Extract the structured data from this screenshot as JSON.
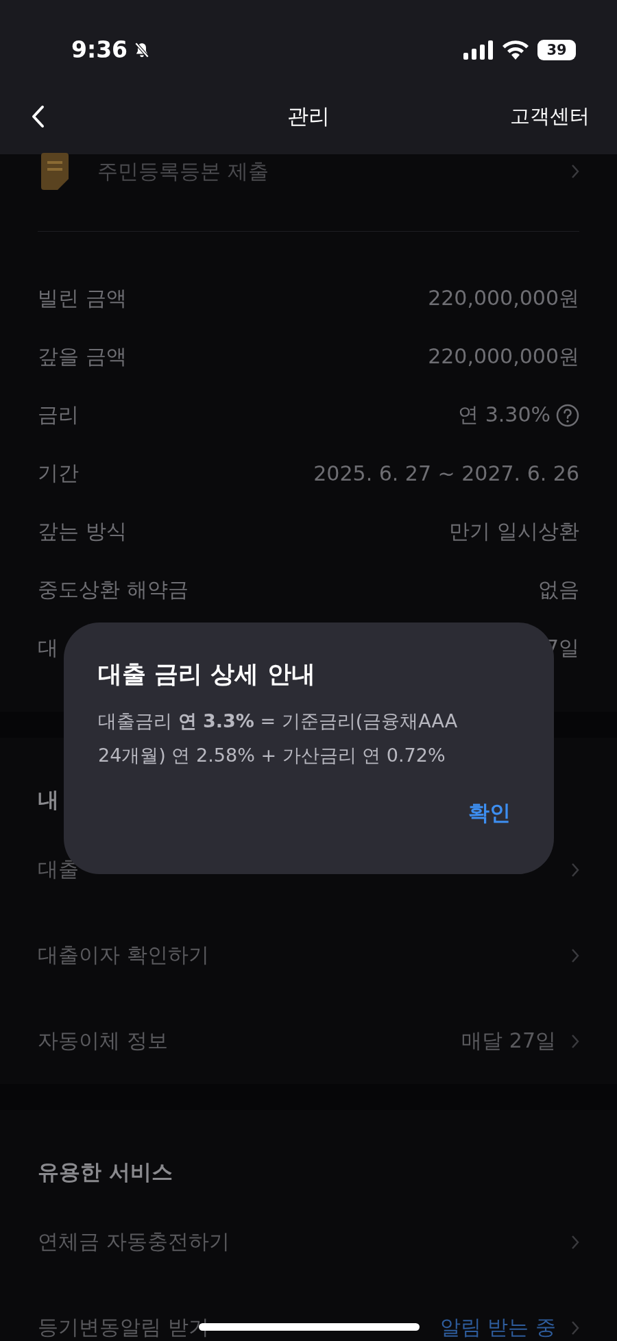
{
  "status_bar": {
    "time": "9:36",
    "battery": "39"
  },
  "nav": {
    "title": "관리",
    "action": "고객센터"
  },
  "document_row": {
    "label": "주민등록등본 제출"
  },
  "details": [
    {
      "label": "빌린 금액",
      "value": "220,000,000원",
      "help": false
    },
    {
      "label": "갚을 금액",
      "value": "220,000,000원",
      "help": false
    },
    {
      "label": "금리",
      "value": "연 3.30%",
      "help": true
    },
    {
      "label": "기간",
      "value": "2025. 6. 27 ~ 2027. 6. 26",
      "help": false
    },
    {
      "label": "갚는 방식",
      "value": "만기 일시상환",
      "help": false
    },
    {
      "label": "중도상환 해약금",
      "value": "없음",
      "help": false
    },
    {
      "label": "대",
      "value": "7일",
      "help": false
    }
  ],
  "sections": [
    {
      "title": "내",
      "items": [
        {
          "label": "대출"
        },
        {
          "label": "대출이자 확인하기"
        },
        {
          "label": "자동이체 정보",
          "value": "매달 27일",
          "accent": false
        }
      ]
    },
    {
      "title": "유용한 서비스",
      "items": [
        {
          "label": "연체금 자동충전하기"
        },
        {
          "label": "등기변동알림 받기",
          "value": "알림 받는 중",
          "accent": true
        }
      ]
    }
  ],
  "dialog": {
    "title": "대출 금리 상세 안내",
    "body": "대출금리 **연 3.3%** = 기준금리(금융채AAA 24개월) 연 2.58% + 가산금리 연 0.72%",
    "button": "확인"
  }
}
